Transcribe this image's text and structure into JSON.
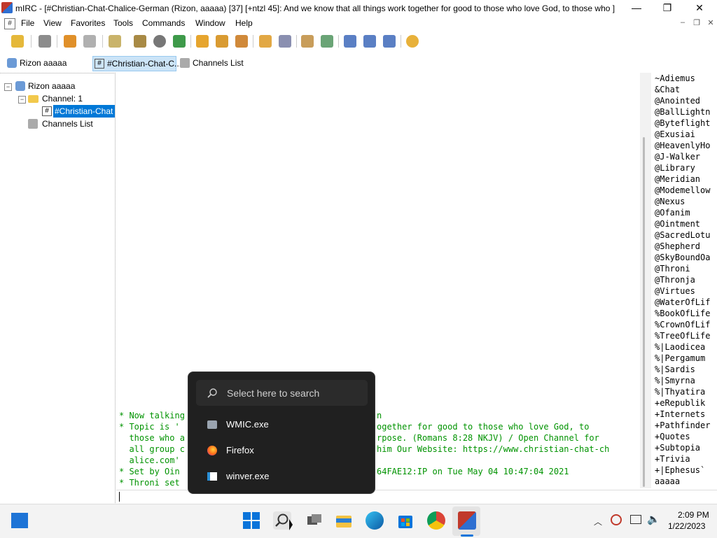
{
  "title": "mIRC - [#Christian-Chat-Chalice-German (Rizon, aaaaa) [37] [+ntzl 45]: And we know that all things work together for good to those who love God, to those who ]",
  "window_controls": {
    "minimize": "—",
    "maximize": "❐",
    "close": "✕"
  },
  "menu": {
    "items": [
      "File",
      "View",
      "Favorites",
      "Tools",
      "Commands",
      "Window",
      "Help"
    ],
    "mdi": [
      "–",
      "❐",
      "✕"
    ]
  },
  "switchbar": {
    "server": "Rizon aaaaa",
    "channel": "#Christian-Chat-C...",
    "channels_list": "Channels List"
  },
  "tree": {
    "server": "Rizon aaaaa",
    "folder": "Channel: 1",
    "channel": "#Christian-Chat",
    "channels_list": "Channels List"
  },
  "chat": {
    "lines": [
      "* Now talking",
      "* Topic is '",
      "  those who a",
      "  all group c",
      "  alice.com'",
      "* Set by Oin",
      "* Throni set"
    ],
    "right_fragments": [
      "n",
      "ogether for good to those who love God, to",
      "rpose. (Romans 8:28 NKJV) / Open Channel for",
      "him Our Website: https://www.christian-chat-ch",
      "",
      "64FAE12:IP on Tue May 04 10:47:04 2021",
      ""
    ]
  },
  "nicklist": [
    "~Adiemus",
    "&Chat",
    "@Anointed",
    "@BallLightn",
    "@Byteflight",
    "@Exusiai",
    "@HeavenlyHo",
    "@J-Walker",
    "@Library",
    "@Meridian",
    "@Modemellow",
    "@Nexus",
    "@Ofanim",
    "@Ointment",
    "@SacredLotu",
    "@Shepherd",
    "@SkyBoundOa",
    "@Throni",
    "@Thronja",
    "@Virtues",
    "@WaterOfLif",
    "%BookOfLife",
    "%CrownOfLif",
    "%TreeOfLife",
    "%|Laodicea",
    "%|Pergamum",
    "%|Sardis",
    "%|Smyrna",
    "%|Thyatira",
    "+eRepublik",
    "+Internets",
    "+Pathfinder",
    "+Quotes",
    "+Subtopia",
    "+Trivia",
    "+|Ephesus`",
    "aaaaa"
  ],
  "search": {
    "placeholder": "Select here to search",
    "results": [
      {
        "label": "WMIC.exe",
        "icon": "console-icon"
      },
      {
        "label": "Firefox",
        "icon": "firefox-icon"
      },
      {
        "label": "winver.exe",
        "icon": "winver-icon"
      }
    ]
  },
  "taskbar": {
    "time": "2:09 PM",
    "date": "1/22/2023",
    "apps": [
      "start-icon",
      "search-icon",
      "task-view-icon",
      "file-explorer-icon",
      "edge-icon",
      "store-icon",
      "chrome-icon",
      "mirc-icon"
    ]
  },
  "colors": {
    "chat_text": "#009300",
    "selection": "#0078d7",
    "popup_bg": "#202020"
  }
}
